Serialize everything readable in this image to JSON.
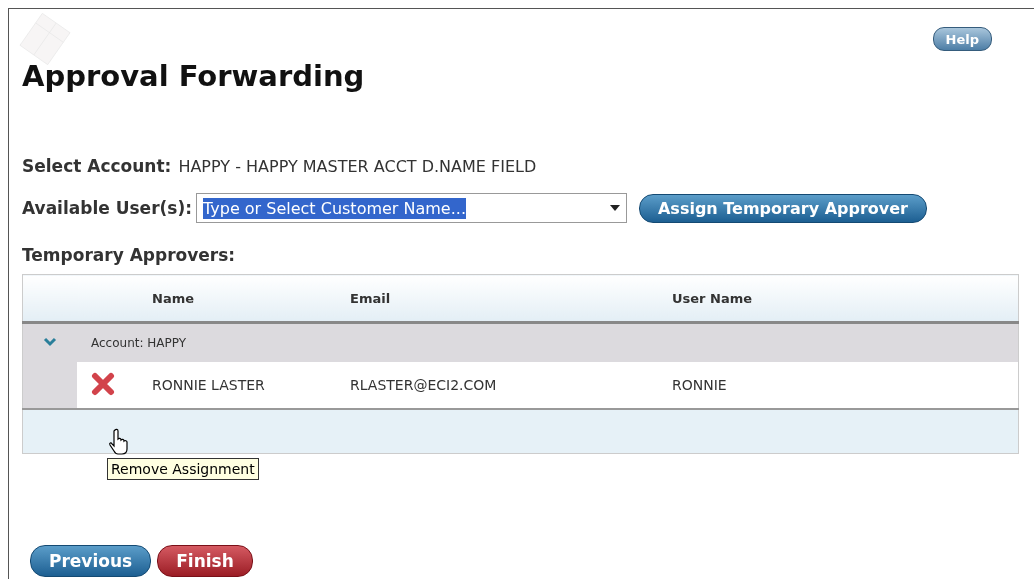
{
  "help_button": "Help",
  "title": "Approval Forwarding",
  "select_account": {
    "label": "Select Account:",
    "value": "HAPPY - HAPPY MASTER ACCT D.NAME FIELD"
  },
  "available_users": {
    "label": "Available User(s):",
    "value": "Type or Select Customer Name...",
    "assign_button": "Assign Temporary Approver"
  },
  "temporary_approvers": {
    "label": "Temporary Approvers:",
    "table": {
      "columns": [
        "Name",
        "Email",
        "User Name"
      ],
      "groups": [
        {
          "label": "Account: HAPPY",
          "expanded": true,
          "rows": [
            {
              "name": "RONNIE LASTER",
              "email": "RLASTER@ECI2.COM",
              "user_name": "RONNIE"
            }
          ]
        }
      ]
    },
    "tooltip": "Remove Assignment"
  },
  "buttons": [
    {
      "label": "Previous",
      "kind": "secondary"
    },
    {
      "label": "Finish",
      "kind": "primary"
    }
  ]
}
